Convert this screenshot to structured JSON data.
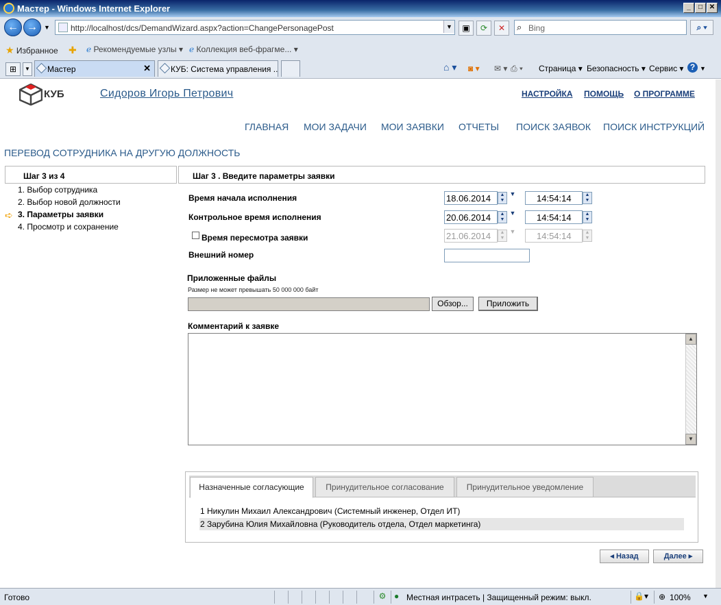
{
  "window": {
    "title": "Мастер - Windows Internet Explorer"
  },
  "browser": {
    "url": "http://localhost/dcs/DemandWizard.aspx?action=ChangePersonagePost",
    "search_placeholder": "Bing",
    "favorites_label": "Избранное",
    "fav_items": [
      "Рекомендуемые узлы ▾",
      "Коллекция веб-фрагме... ▾"
    ],
    "tabs": [
      {
        "label": "Мастер",
        "active": true
      },
      {
        "label": "КУБ: Система управления ...",
        "active": false
      }
    ],
    "commands": {
      "page": "Страница ▾",
      "security": "Безопасность ▾",
      "service": "Сервис ▾"
    }
  },
  "header": {
    "logo_text": "КУБ",
    "username": "Сидоров Игорь Петрович",
    "links": {
      "settings": "НАСТРОЙКА",
      "help": "ПОМОЩЬ",
      "about": "О ПРОГРАММЕ"
    }
  },
  "mainnav": [
    "ГЛАВНАЯ",
    "МОИ ЗАДАЧИ",
    "МОИ ЗАЯВКИ",
    "ОТЧЕТЫ",
    "ПОИСК ЗАЯВОК",
    "ПОИСК ИНСТРУКЦИЙ"
  ],
  "page_title": "ПЕРЕВОД СОТРУДНИКА НА ДРУГУЮ ДОЛЖНОСТЬ",
  "wizard": {
    "step_indicator": "Шаг 3 из 4",
    "steps": [
      "1. Выбор сотрудника",
      "2. Выбор новой должности",
      "3. Параметры заявки",
      "4. Просмотр и сохранение"
    ],
    "current_step": 3,
    "panel_title": "Шаг 3 . Введите параметры заявки"
  },
  "form": {
    "start_time_label": "Время начала исполнения",
    "start_date": "18.06.2014",
    "start_time": "14:54:14",
    "control_time_label": "Контрольное время исполнения",
    "control_date": "20.06.2014",
    "control_time": "14:54:14",
    "review_time_label": "Время пересмотра заявки",
    "review_checked": false,
    "review_date": "21.06.2014",
    "review_time": "14:54:14",
    "external_number_label": "Внешний номер",
    "external_number": "",
    "files_label": "Приложенные файлы",
    "files_note": "Размер не может превышать 50 000 000 байт",
    "browse_button": "Обзор...",
    "attach_button": "Приложить",
    "comment_label": "Комментарий к заявке",
    "comment": ""
  },
  "approvals": {
    "tabs": [
      "Назначенные согласующие",
      "Принудительное согласование",
      "Принудительное уведомление"
    ],
    "active_tab": 0,
    "rows": [
      "1 Никулин Михаил Александрович (Системный инженер, Отдел ИТ)",
      "2 Зарубина Юлия Михайловна (Руководитель отдела, Отдел маркетинга)"
    ]
  },
  "buttons": {
    "back": "◂ Назад",
    "next": "Далее ▸"
  },
  "statusbar": {
    "status": "Готово",
    "zone": "Местная интрасеть | Защищенный режим: выкл.",
    "zoom": "100%"
  }
}
